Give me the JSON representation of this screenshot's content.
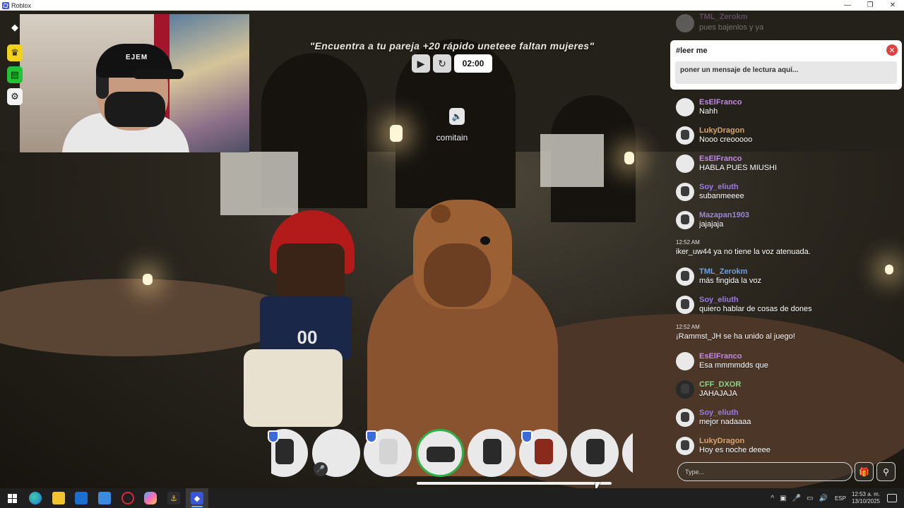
{
  "window": {
    "title": "Roblox",
    "controls": {
      "minimize": "—",
      "maximize": "❐",
      "close": "✕"
    }
  },
  "webcam": {
    "cap_text": "EJEM"
  },
  "hud": {
    "roblox_icon": "roblox-menu-icon",
    "crown_icon": "crown-icon",
    "chat_icon": "chat-icon",
    "gear_icon": "gear-icon"
  },
  "top_bar": {
    "message": "\"Encuentra a tu pareja +20 rápido uneteee faltan mujeres\"",
    "play_glyph": "▶",
    "reset_glyph": "↻",
    "timer": "02:00"
  },
  "speaker": {
    "name": "comitain",
    "icon": "speaker-icon"
  },
  "chat": {
    "faded_top": {
      "name": "TML_Zerokm",
      "message": "pues bajenlos y ya"
    },
    "pinned": {
      "title": "#leer me",
      "close": "✕",
      "text": "poner un mensaje de lectura aquí..."
    },
    "items": [
      {
        "kind": "user",
        "name": "EsElFranco",
        "color": "#c08ae0",
        "message": "Nahh",
        "avatar": "plain"
      },
      {
        "kind": "user",
        "name": "LukyDragon",
        "color": "#d7a36a",
        "message": "Nooo creooooo",
        "avatar": "pic"
      },
      {
        "kind": "user",
        "name": "EsElFranco",
        "color": "#c08ae0",
        "message": "HABLA PUES MIUSHI",
        "avatar": "plain"
      },
      {
        "kind": "user",
        "name": "Soy_eliuth",
        "color": "#9a7ae0",
        "message": "subanmeeee",
        "avatar": "pic"
      },
      {
        "kind": "user",
        "name": "Mazapan1903",
        "color": "#9a86d9",
        "message": "jajajaja",
        "avatar": "pic"
      },
      {
        "kind": "system",
        "time": "12:52 AM",
        "message": "iker_uw44 ya no tiene la voz atenuada."
      },
      {
        "kind": "user",
        "name": "TML_Zerokm",
        "color": "#6ea0e0",
        "message": "más fingida la voz",
        "avatar": "pic"
      },
      {
        "kind": "user",
        "name": "Soy_eliuth",
        "color": "#9a7ae0",
        "message": "quiero hablar de cosas de dones",
        "avatar": "pic"
      },
      {
        "kind": "system",
        "time": "12:52 AM",
        "message": "¡Rammst_JH se ha unido al juego!"
      },
      {
        "kind": "user",
        "name": "EsElFranco",
        "color": "#c08ae0",
        "message": "Esa mmmmdds que",
        "avatar": "plain"
      },
      {
        "kind": "user",
        "name": "CFF_DXOR",
        "color": "#8fd18a",
        "message": "JAHAJAJA",
        "avatar": "dark"
      },
      {
        "kind": "user",
        "name": "Soy_eliuth",
        "color": "#9a7ae0",
        "message": "mejor nadaaaa",
        "avatar": "pic"
      },
      {
        "kind": "user",
        "name": "LukyDragon",
        "color": "#d7a36a",
        "message": "Hoy es noche deeee",
        "avatar": "pic"
      }
    ],
    "input_placeholder": "Type...",
    "gift_icon": "gift-icon",
    "people_icon": "people-icon"
  },
  "carousel": {
    "mic_off_icon": "mic-off-icon",
    "shield_icon": "shield-icon"
  },
  "taskbar": {
    "start_icon": "windows-start-icon",
    "language": "ESP",
    "time": "12:53 a. m.",
    "date": "13/10/2025",
    "tray_glyphs": [
      "^",
      "▣",
      "🎤",
      "▭",
      "🔊"
    ]
  }
}
